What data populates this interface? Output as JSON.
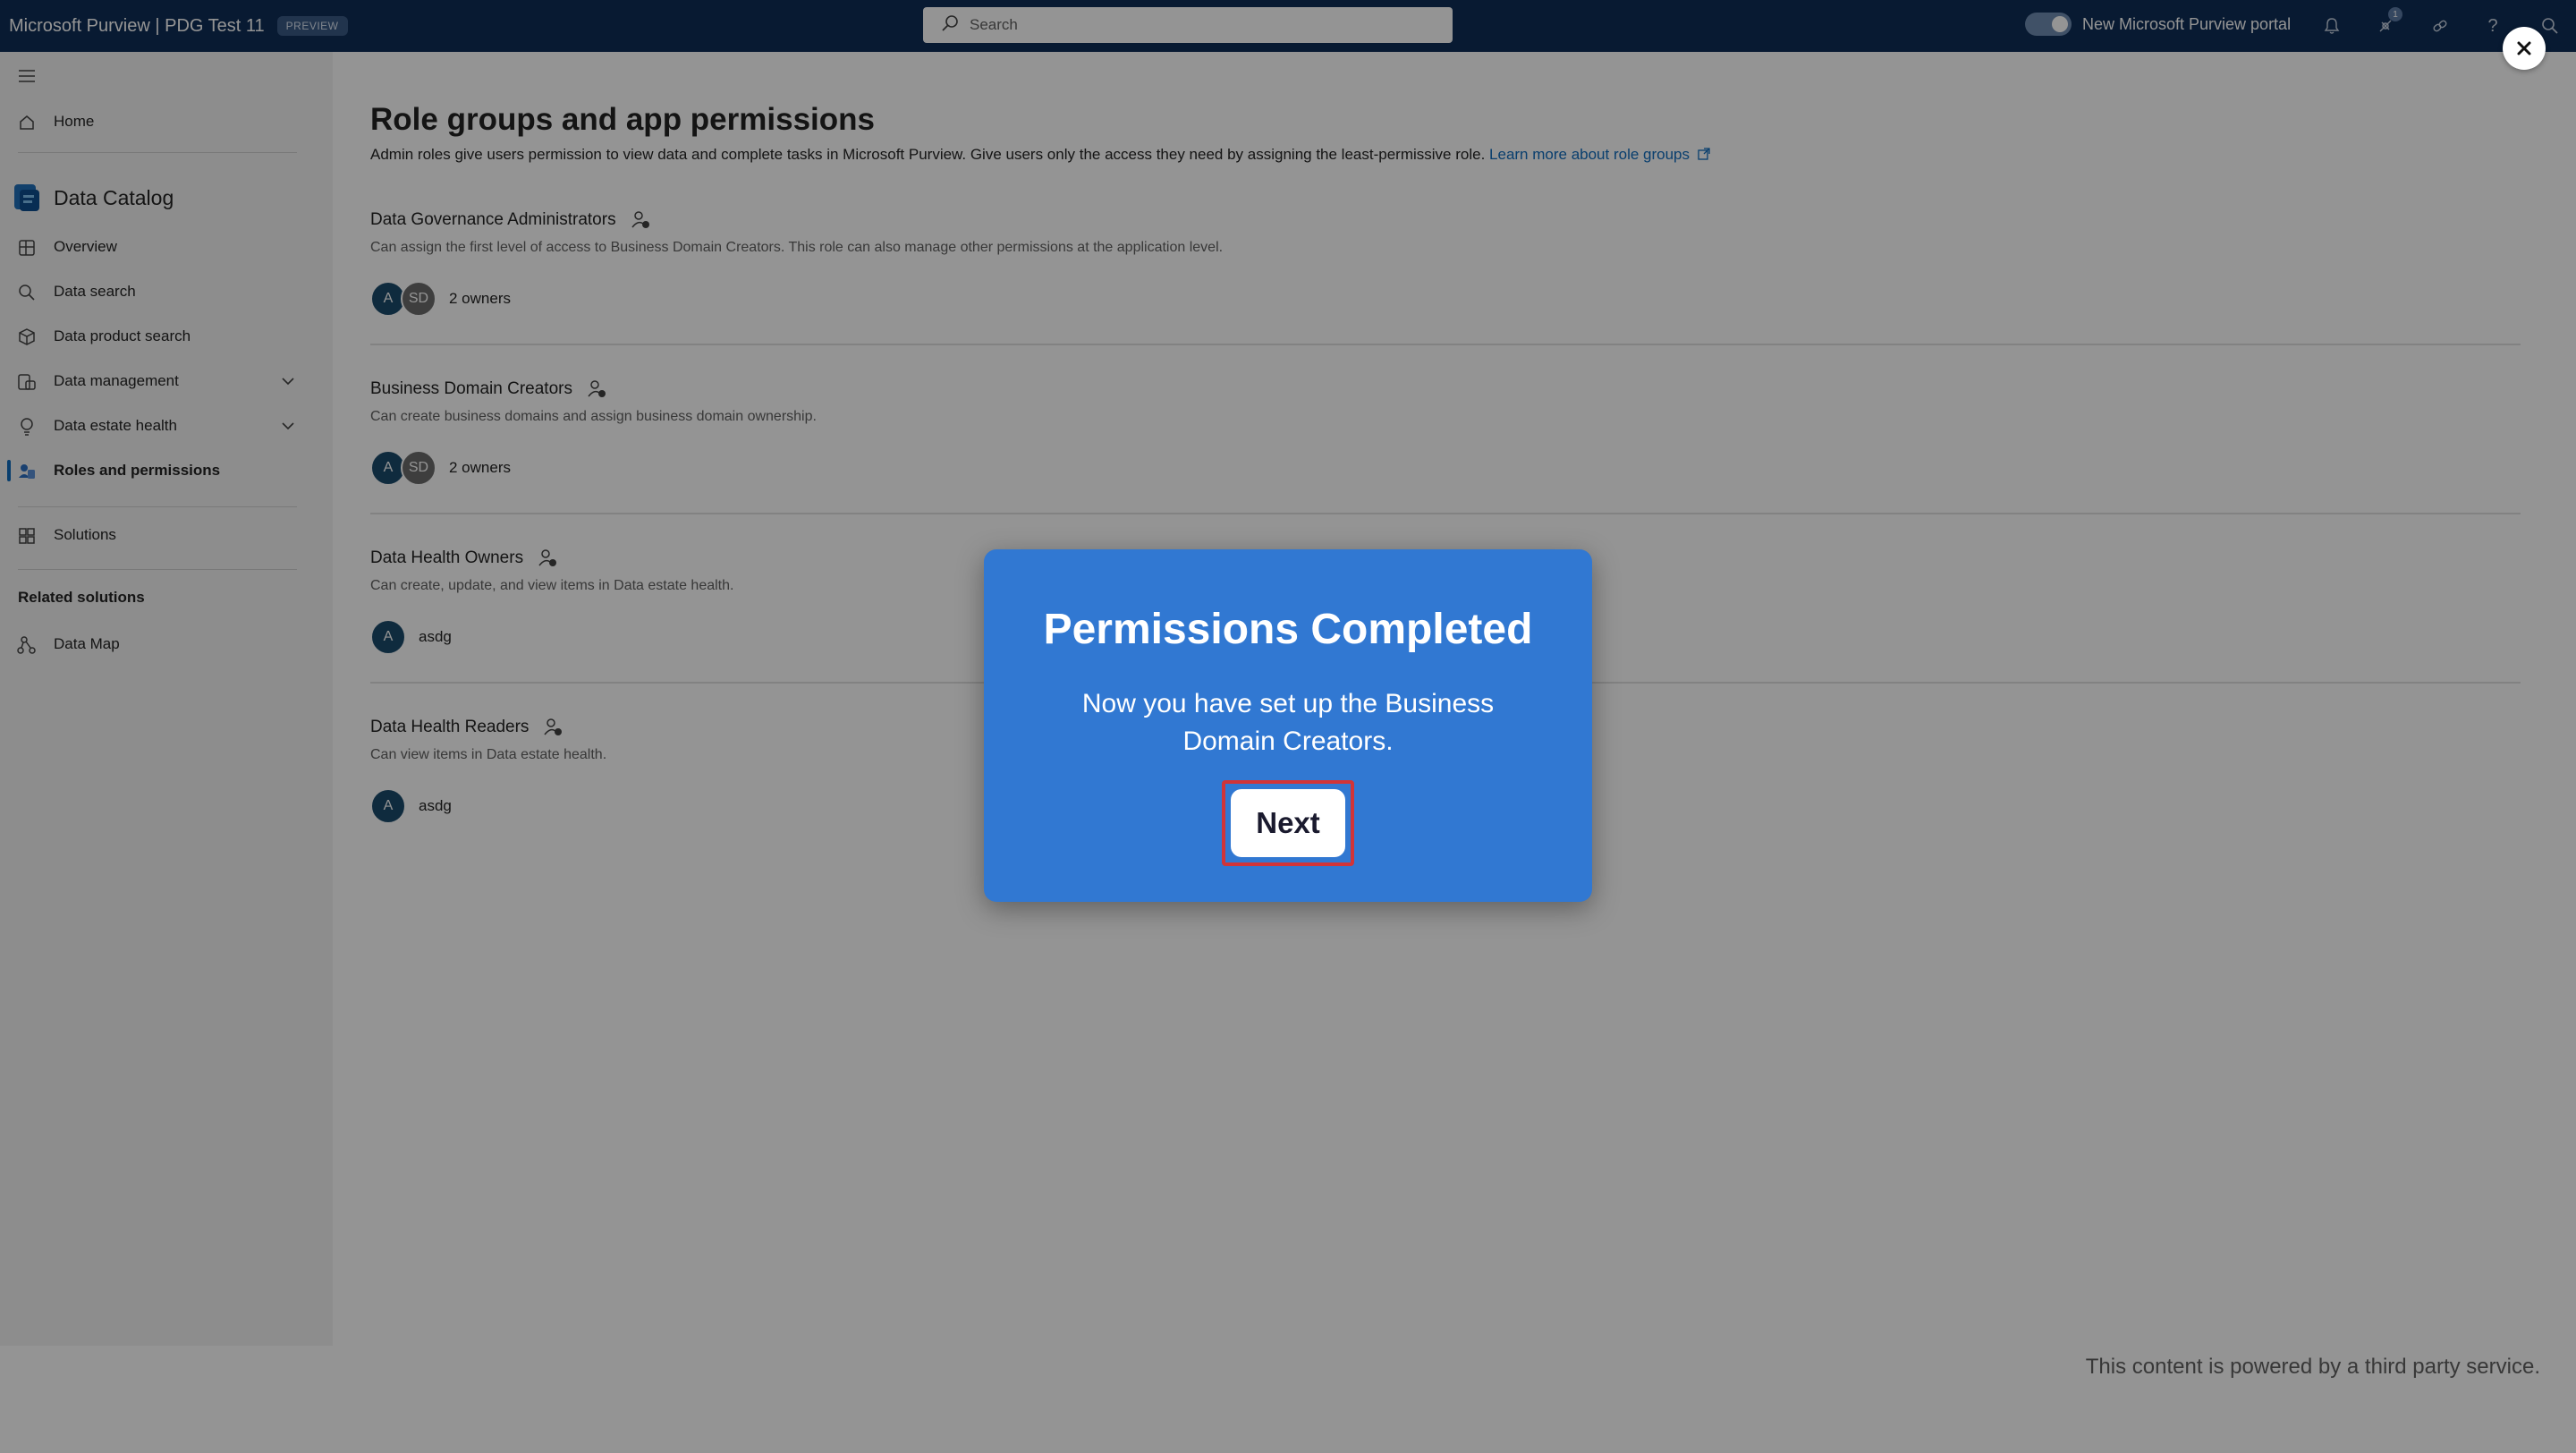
{
  "topbar": {
    "app_title": "Microsoft Purview | PDG Test 11",
    "preview_badge": "PREVIEW",
    "search_placeholder": "Search",
    "portal_toggle_label": "New Microsoft Purview portal",
    "notification_count": "1"
  },
  "sidebar": {
    "home": "Home",
    "section_title": "Data Catalog",
    "items": [
      {
        "label": "Overview"
      },
      {
        "label": "Data search"
      },
      {
        "label": "Data product search"
      },
      {
        "label": "Data management"
      },
      {
        "label": "Data estate health"
      },
      {
        "label": "Roles and permissions"
      }
    ],
    "solutions": "Solutions",
    "related_title": "Related solutions",
    "data_map": "Data Map"
  },
  "main": {
    "title": "Role groups and app permissions",
    "description": "Admin roles give users permission to view data and complete tasks in Microsoft Purview. Give users only the access they need by assigning the least-permissive role.",
    "learn_more": "Learn more about role groups",
    "roles": [
      {
        "name": "Data Governance Administrators",
        "description": "Can assign the first level of access to Business Domain Creators. This role can also manage other permissions at the application level.",
        "avatars": [
          "A",
          "SD"
        ],
        "owners_text": "2 owners"
      },
      {
        "name": "Business Domain Creators",
        "description": "Can create business domains and assign business domain ownership.",
        "avatars": [
          "A",
          "SD"
        ],
        "owners_text": "2 owners"
      },
      {
        "name": "Data Health Owners",
        "description": "Can create, update, and view items in Data estate health.",
        "avatars": [
          "A"
        ],
        "owners_text": "asdg"
      },
      {
        "name": "Data Health Readers",
        "description": "Can view items in Data estate health.",
        "avatars": [
          "A"
        ],
        "owners_text": "asdg"
      }
    ]
  },
  "modal": {
    "title": "Permissions Completed",
    "body": "Now you have set up the Business Domain Creators.",
    "next_label": "Next"
  },
  "footer": {
    "text": "This content is powered by a third party service."
  },
  "colors": {
    "topbar": "#0f2e57",
    "modal": "#3178d2",
    "focus_outline": "#d13438",
    "link": "#0f6cbd"
  }
}
